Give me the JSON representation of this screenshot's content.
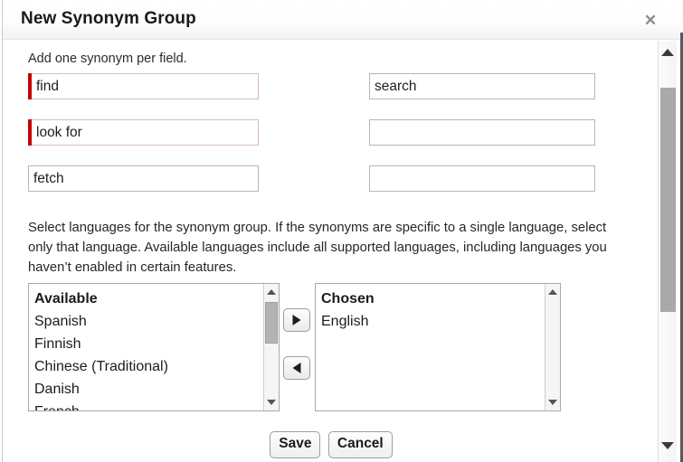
{
  "dialog": {
    "title": "New Synonym Group",
    "close_icon": "close-icon",
    "close_label": "✕"
  },
  "form": {
    "hint": "Add one synonym per field.",
    "synonyms": [
      {
        "value": "find",
        "required": true,
        "placeholder": ""
      },
      {
        "value": "search",
        "required": false,
        "placeholder": ""
      },
      {
        "value": "look for",
        "required": true,
        "placeholder": ""
      },
      {
        "value": "",
        "required": false,
        "placeholder": ""
      },
      {
        "value": "fetch",
        "required": false,
        "placeholder": ""
      },
      {
        "value": "",
        "required": false,
        "placeholder": ""
      }
    ]
  },
  "languages": {
    "description": "Select languages for the synonym group. If the synonyms are specific to a single language, select only that language. Available languages include all supported languages, including languages you haven’t enabled in certain features.",
    "available": {
      "header": "Available",
      "items": [
        "Spanish",
        "Finnish",
        "Chinese (Traditional)",
        "Danish",
        "French"
      ]
    },
    "chosen": {
      "header": "Chosen",
      "items": [
        "English"
      ]
    },
    "add_button_icon": "arrow-right-icon",
    "remove_button_icon": "arrow-left-icon"
  },
  "footer": {
    "save_label": "Save",
    "cancel_label": "Cancel"
  },
  "scrollbar": {
    "up_icon": "scroll-up-arrow-icon",
    "down_icon": "scroll-down-arrow-icon"
  },
  "colors": {
    "required_marker": "#c00000",
    "title_text": "#1a1a1a",
    "border": "#b6b6b6",
    "thumb": "#a9a9a9"
  }
}
